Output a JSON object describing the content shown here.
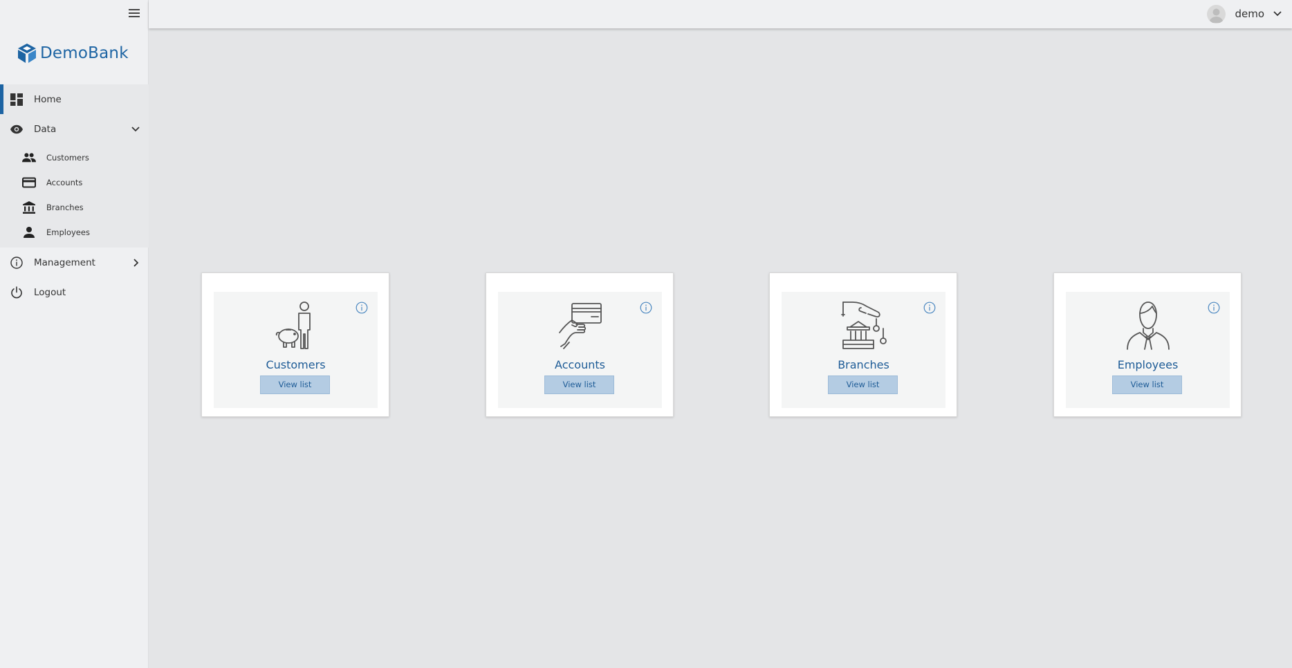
{
  "app": {
    "logo_text": "DemoBank",
    "accent": "#1d64a3"
  },
  "header": {
    "username": "demo"
  },
  "sidebar": {
    "items": [
      {
        "label": "Home",
        "icon": "dashboard-icon"
      },
      {
        "label": "Data",
        "icon": "eye-icon"
      },
      {
        "label": "Management",
        "icon": "info-icon"
      },
      {
        "label": "Logout",
        "icon": "power-icon"
      }
    ],
    "data_sub": [
      {
        "label": "Customers",
        "icon": "people-icon"
      },
      {
        "label": "Accounts",
        "icon": "credit-card-icon"
      },
      {
        "label": "Branches",
        "icon": "bank-icon"
      },
      {
        "label": "Employees",
        "icon": "person-icon"
      }
    ]
  },
  "cards": [
    {
      "title": "Customers",
      "button": "View list",
      "icon": "piggy-bank-person-icon"
    },
    {
      "title": "Accounts",
      "button": "View list",
      "icon": "hand-card-icon"
    },
    {
      "title": "Branches",
      "button": "View list",
      "icon": "bank-hand-icon"
    },
    {
      "title": "Employees",
      "button": "View list",
      "icon": "employee-icon"
    }
  ]
}
